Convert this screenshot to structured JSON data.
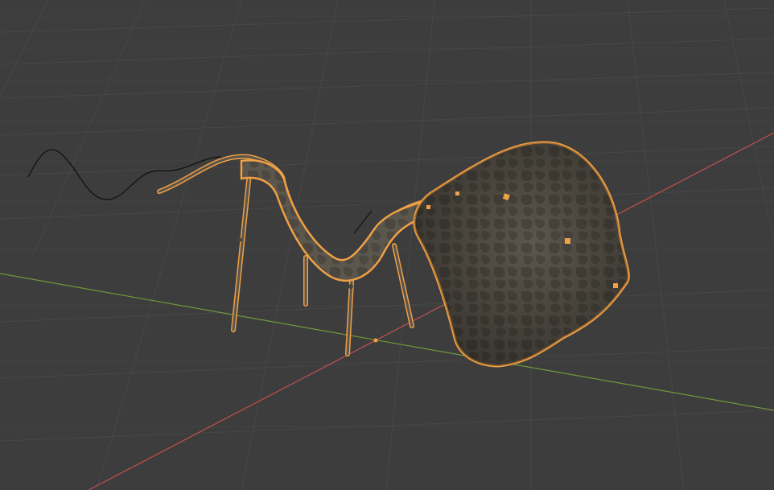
{
  "viewport": {
    "background": "#3d3d3d",
    "grid_color": "#474747",
    "x_axis_color": "#c25050",
    "y_axis_color": "#6e9a3a",
    "selection_outline_color": "#f0a045",
    "object_fill": "#5a554c",
    "curve_color": "#111111"
  },
  "scene": {
    "object": "creature-mesh",
    "selected": true,
    "view": "perspective",
    "shading": "material-preview"
  }
}
